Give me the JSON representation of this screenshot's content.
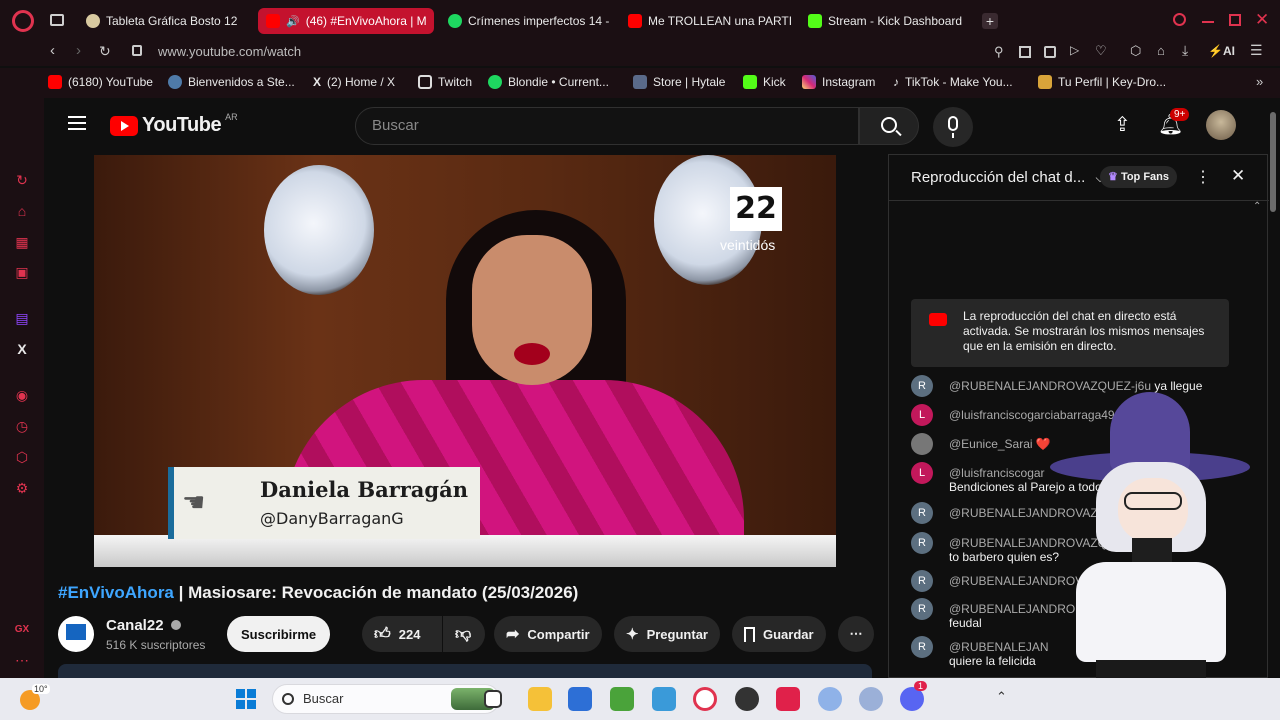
{
  "browser": {
    "tabs": [
      {
        "label": "Tableta Gráfica Bosto 12"
      },
      {
        "label": "(46) #EnVivoAhora | M"
      },
      {
        "label": "Crímenes imperfectos 14 -"
      },
      {
        "label": "Me TROLLEAN una PARTI"
      },
      {
        "label": "Stream - Kick Dashboard"
      }
    ],
    "url": "www.youtube.com/watch",
    "ai_label": "AI",
    "bookmarks": [
      {
        "label": "(6180) YouTube"
      },
      {
        "label": "Bienvenidos a Ste..."
      },
      {
        "label": "(2) Home / X"
      },
      {
        "label": "Twitch"
      },
      {
        "label": "Blondie • Current..."
      },
      {
        "label": "Store | Hytale"
      },
      {
        "label": "Kick"
      },
      {
        "label": "Instagram"
      },
      {
        "label": "TikTok - Make You..."
      },
      {
        "label": "Tu Perfil | Key-Dro..."
      }
    ],
    "sidebar_bottom": "GX"
  },
  "youtube": {
    "logo_text": "YouTube",
    "region": "AR",
    "search_placeholder": "Buscar",
    "notif_count": "9+"
  },
  "video": {
    "lower_third_name": "Daniela Barragán",
    "lower_third_handle": "@DanyBarraganG",
    "channel_logo": "22",
    "channel_logo_text": "veintidós",
    "title_hashtag": "#EnVivoAhora",
    "title_rest": " | Masiosare: Revocación de mandato (25/03/2026)",
    "channel_name": "Canal22",
    "subscribers": "516 K suscriptores",
    "subscribe_label": "Suscribirme",
    "likes": "224",
    "share_label": "Compartir",
    "ask_label": "Preguntar",
    "save_label": "Guardar"
  },
  "chat": {
    "title": "Reproducción del chat d...",
    "top_fans_label": "Top Fans",
    "notice": "La reproducción del chat en directo está activada. Se mostrarán los mismos mensajes que en la emisión en directo.",
    "messages": [
      {
        "initial": "R",
        "color": "#5c6f80",
        "author": "@RUBENALEJANDROVAZQUEZ-j6u",
        "text": "ya llegue"
      },
      {
        "initial": "L",
        "color": "#c2185b",
        "author": "@luisfranciscogarciabarraga491",
        "text": "o..."
      },
      {
        "initial": "",
        "color": "#777777",
        "author": "@Eunice_Sarai",
        "text": "❤️"
      },
      {
        "initial": "L",
        "color": "#c2185b",
        "author": "@luisfranciscogar",
        "text": "Bendiciones al Parejo a todo"
      },
      {
        "initial": "R",
        "color": "#5c6f80",
        "author": "@RUBENALEJANDROVAZ",
        "text": ""
      },
      {
        "initial": "R",
        "color": "#5c6f80",
        "author": "@RUBENALEJANDROVAZQU",
        "text": "to barbero quien es?"
      },
      {
        "initial": "R",
        "color": "#5c6f80",
        "author": "@RUBENALEJANDROV",
        "text": ""
      },
      {
        "initial": "R",
        "color": "#5c6f80",
        "author": "@RUBENALEJANDRO",
        "text": "feudal"
      },
      {
        "initial": "R",
        "color": "#5c6f80",
        "author": "@RUBENALEJAN",
        "text": "quiere la felicida"
      }
    ]
  },
  "taskbar": {
    "weather_temp": "10°",
    "search_placeholder": "Buscar",
    "discord_badge": "1"
  }
}
